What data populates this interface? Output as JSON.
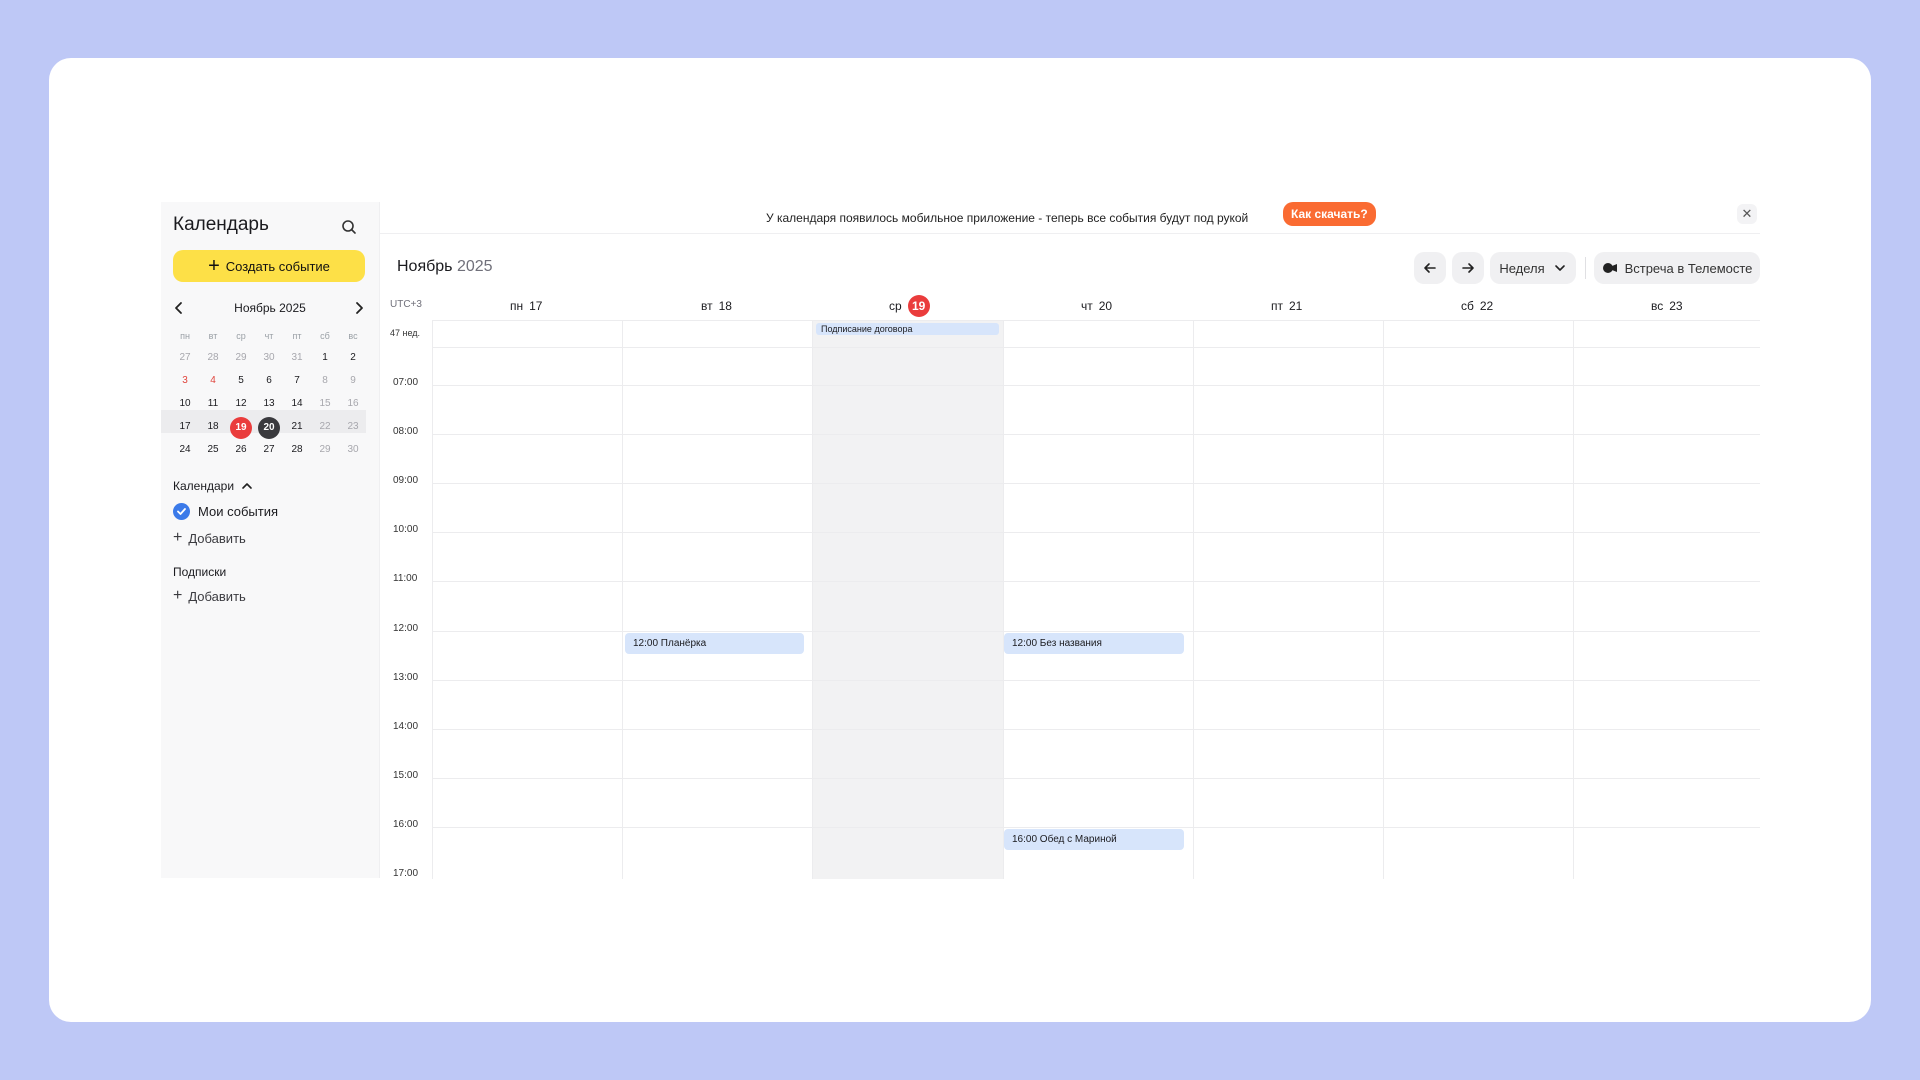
{
  "sidebar": {
    "title": "Календарь",
    "create_label": "Создать событие",
    "mini_month": "Ноябрь 2025",
    "dow": [
      "пн",
      "вт",
      "ср",
      "чт",
      "пт",
      "сб",
      "вс"
    ],
    "weeks": [
      [
        "27",
        "28",
        "29",
        "30",
        "31",
        "1",
        "2"
      ],
      [
        "3",
        "4",
        "5",
        "6",
        "7",
        "8",
        "9"
      ],
      [
        "10",
        "11",
        "12",
        "13",
        "14",
        "15",
        "16"
      ],
      [
        "17",
        "18",
        "19",
        "20",
        "21",
        "22",
        "23"
      ],
      [
        "24",
        "25",
        "26",
        "27",
        "28",
        "29",
        "30"
      ]
    ],
    "calendars_title": "Календари",
    "my_events": "Мои события",
    "add_label": "Добавить",
    "subscriptions_title": "Подписки",
    "add_label_2": "Добавить"
  },
  "banner": {
    "text": "У календаря появилось мобильное приложение - теперь все события будут под рукой",
    "button": "Как скачать?",
    "close": "✕"
  },
  "header": {
    "month": "Ноябрь",
    "year": "2025",
    "prev": "←",
    "next": "→",
    "view": "Неделя",
    "meet": "Встреча в Телемосте"
  },
  "grid": {
    "timezone": "UTC+3",
    "week_label": "47 нед.",
    "days": [
      {
        "dow": "пн",
        "num": "17"
      },
      {
        "dow": "вт",
        "num": "18"
      },
      {
        "dow": "ср",
        "num": "19"
      },
      {
        "dow": "чт",
        "num": "20"
      },
      {
        "dow": "пт",
        "num": "21"
      },
      {
        "dow": "сб",
        "num": "22"
      },
      {
        "dow": "вс",
        "num": "23"
      }
    ],
    "hours": [
      "07:00",
      "08:00",
      "09:00",
      "10:00",
      "11:00",
      "12:00",
      "13:00",
      "14:00",
      "15:00",
      "16:00",
      "17:00"
    ],
    "events": [
      {
        "title": "Подписание договора",
        "day": "ср 19",
        "allday": true
      },
      {
        "title": "12:00 Планёрка",
        "day": "вт 18",
        "allday": false
      },
      {
        "title": "12:00 Без названия",
        "day": "чт 20",
        "allday": false
      },
      {
        "title": "16:00 Обед с Мариной",
        "day": "чт 20",
        "allday": false
      }
    ]
  },
  "colors": {
    "accent_yellow": "#fde047",
    "today_red": "#ea3c3c",
    "banner_orange": "#fa6b32",
    "event_blue": "#d7e5fb",
    "checkbox_blue": "#3b7ae9"
  }
}
